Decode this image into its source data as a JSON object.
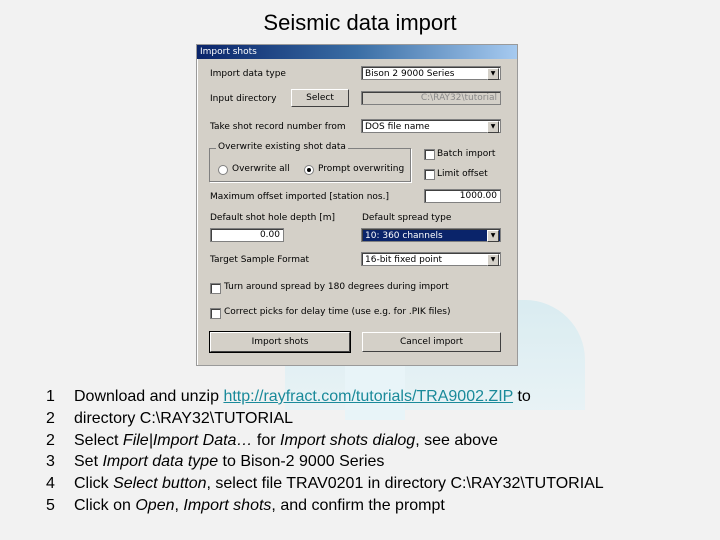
{
  "slide": {
    "title": "Seismic data import"
  },
  "dialog": {
    "title": "Import shots",
    "import_data_type": {
      "label": "Import data type",
      "value": "Bison 2 9000 Series"
    },
    "input_directory": {
      "label": "Input directory",
      "select_button": "Select",
      "value": "C:\\RAY32\\tutorial"
    },
    "shot_record_number": {
      "label": "Take shot record number from",
      "value": "DOS file name"
    },
    "overwrite_group": {
      "legend": "Overwrite existing shot data",
      "options": [
        {
          "label": "Overwrite all",
          "selected": false
        },
        {
          "label": "Prompt overwriting",
          "selected": true
        }
      ]
    },
    "batch_import": {
      "label": "Batch import",
      "checked": false
    },
    "limit_offset": {
      "label": "Limit offset",
      "checked": false
    },
    "max_offset": {
      "label": "Maximum offset imported [station nos.]",
      "value": "1000.00"
    },
    "shot_hole_depth": {
      "label": "Default shot hole depth [m]",
      "value": "0.00"
    },
    "spread_type": {
      "label": "Default spread type",
      "value": "10: 360 channels"
    },
    "sample_format": {
      "label": "Target Sample Format",
      "value": "16-bit fixed point"
    },
    "turn_around": {
      "label": "Turn around spread by 180 degrees during import",
      "checked": false
    },
    "correct_picks": {
      "label": "Correct picks for delay time (use e.g. for .PIK files)",
      "checked": false
    },
    "import_button": "Import shots",
    "cancel_button": "Cancel import"
  },
  "steps": [
    {
      "num": "1",
      "parts": {
        "a": "Download and unzip ",
        "link": "http://rayfract.com/tutorials/TRA9002.ZIP",
        "b": " to"
      }
    },
    {
      "num": "2",
      "parts": {
        "a": "directory C:\\RAY32\\TUTORIAL"
      }
    },
    {
      "num": "2",
      "parts": {
        "a": "Select ",
        "i1": "File|Import Data…",
        "b": " for ",
        "i2": "Import shots dialog",
        "c": ", see above"
      }
    },
    {
      "num": "3",
      "parts": {
        "a": "Set ",
        "i1": "Import data type",
        "b": " to Bison-2 9000 Series"
      }
    },
    {
      "num": "4",
      "parts": {
        "a": "Click ",
        "i1": "Select button",
        "b": ", select file TRAV0201 in directory C:\\RAY32\\TUTORIAL"
      }
    },
    {
      "num": "5",
      "parts": {
        "a": "Click on ",
        "i1": "Open",
        "b": ", ",
        "i2": "Import shots",
        "c": ", and confirm the prompt"
      }
    }
  ]
}
